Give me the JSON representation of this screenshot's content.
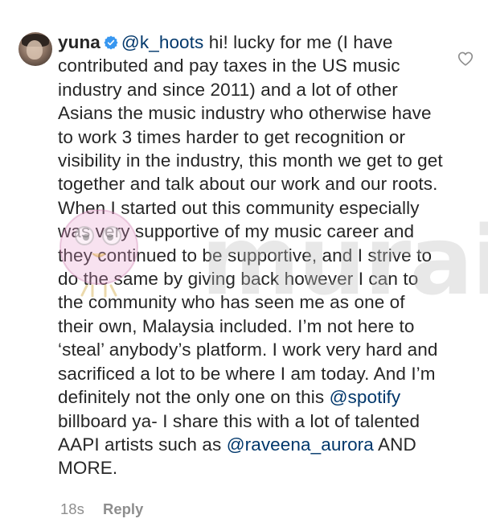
{
  "comment": {
    "username": "yuna",
    "mention_reply_to": "@k_hoots",
    "text_part1": " hi! lucky for me (I have contributed and pay taxes in the US music industry and since 2011) and a lot of other Asians the music industry who otherwise have to work 3 times harder to get recognition or visibility in the industry, this month we get to get together and talk about our work and our roots. When I started out this community especially was very supportive of my music career and they continued to be supportive, and I strive to do the same by giving back however I can to the community who has seen me as one of their own, Malaysia included. I’m not here to ‘steal’ anybody’s platform. I work very hard and sacrificed a lot to be where I am today. And I’m definitely not the only one on this ",
    "mention_spotify": "@spotify",
    "text_part2": " billboard ya- I share this with a lot of talented AAPI artists such as ",
    "mention_raveena": "@raveena_aurora",
    "text_part3": " AND MORE.",
    "age": "18s",
    "reply_label": "Reply"
  },
  "watermark_text": "murai",
  "colors": {
    "text": "#262626",
    "muted": "#8e8e8e",
    "verified_badge": "#3897f0",
    "heart_outline": "#8e8e8e"
  },
  "icons": {
    "avatar": "profile-photo",
    "verified": "verified-badge-icon",
    "like": "heart-outline-icon"
  }
}
